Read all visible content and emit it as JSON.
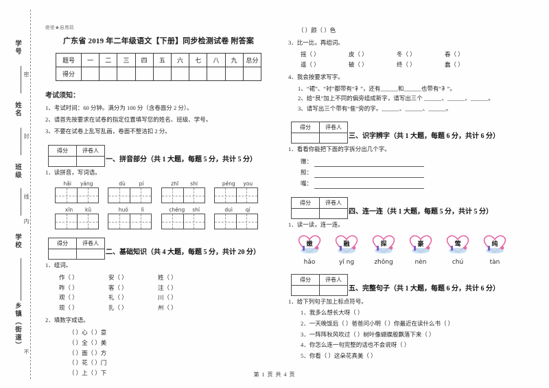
{
  "document": {
    "secret_line": "绝密★启用前",
    "title": "广东省 2019 年二年级语文【下册】同步检测试卷 附答案",
    "footer": "第 1 页 共 4 页"
  },
  "seal_margin": {
    "fields": [
      {
        "label": "学号",
        "sub": "密"
      },
      {
        "label": "姓名",
        "sub": "封"
      },
      {
        "label": "班级",
        "sub": "线"
      },
      {
        "label": "学校",
        "sub": "内"
      },
      {
        "label": "乡镇（街道）",
        "sub": "不"
      }
    ]
  },
  "score_table": {
    "row_labels": [
      "题号",
      "得分"
    ],
    "columns": [
      "一",
      "二",
      "三",
      "四",
      "五",
      "六",
      "七",
      "八",
      "九",
      "总分"
    ],
    "scores": [
      "",
      "",
      "",
      "",
      "",
      "",
      "",
      "",
      "",
      ""
    ]
  },
  "notice": {
    "title": "考试须知：",
    "items": [
      "1、考试时间：60 分钟。满分为 100 分（含卷面分 2 分）。",
      "2、请首先按要求在试卷的指定位置填写您的姓名、班级、学号。",
      "3、不要在试卷上乱写乱画，卷面不整洁扣 2 分。"
    ]
  },
  "grader_box": {
    "score_label": "得分",
    "marker_label": "评卷人"
  },
  "sections": [
    {
      "id": "s1",
      "title": "一、拼音部分（共 1 大题，每题 5 分，共计 5 分）",
      "question": "1．读拼音，写词语。",
      "pinyin_rows": [
        [
          {
            "syllables": [
              "hǎi",
              "yáng"
            ]
          },
          {
            "syllables": [
              "dù",
              "pí"
            ]
          },
          {
            "syllables": [
              "zhī",
              "shi"
            ]
          },
          {
            "syllables": [
              "péng",
              "you"
            ]
          }
        ],
        [
          {
            "syllables": [
              "xīn",
              "kǔ"
            ]
          },
          {
            "syllables": [
              "huó",
              "lì"
            ]
          },
          {
            "syllables": [
              "chéng",
              "shí"
            ]
          },
          {
            "syllables": [
              "duì",
              "qí"
            ]
          }
        ]
      ]
    },
    {
      "id": "s2",
      "title": "二、基础知识（共 4 大题，每题 5 分，共计 20 分）",
      "q1_label": "1．组词。",
      "word_rows": [
        [
          "作（      ）",
          "安（      ）",
          "姓（      ）"
        ],
        [
          "昨（      ）",
          "客（      ）",
          "注（      ）"
        ],
        [
          "观（      ）",
          "礼（      ）",
          "川（      ）"
        ],
        [
          "现（      ）",
          "扎（      ）",
          "州（      ）"
        ]
      ],
      "q2_label": "2．填数字成语。",
      "idioms": [
        "（      ）心（      ）意",
        "（      ）全（      ）美",
        "（      ）面（      ）方",
        "（      ）花（      ）门",
        "（      ）上（      ）下",
        "（      ）颜（      ）色"
      ],
      "q3_label": "3．比一比，再组词。",
      "compare_rows": [
        [
          "摇（      ）",
          "皮（      ）",
          "冬（      ）",
          "春（      ）"
        ],
        [
          "遥（      ）",
          "破（      ）",
          "终（      ）",
          "蠢（      ）"
        ]
      ],
      "q4_label": "4．我会按要求写字。",
      "q4_items": [
        "1、“裙”、“衬”都带有“衤”，还有______和______也带有“衤”。",
        "2、给“艮”加上不同的偏旁组成新字，请写出三个 ______、______、______。",
        "3、请写出三个带有“隹”旁的字。______、______、______。"
      ]
    },
    {
      "id": "s3",
      "title": "三、识字辨字（共 1 大题，每题 6 分，共计 6 分）",
      "question": "1．看看你能把下面的字拆分出几个字。",
      "split_chars": [
        "赠：",
        "照：",
        "嘴："
      ]
    },
    {
      "id": "s4",
      "title": "四、连一连（共 1 大题，每题 5 分，共计 5 分）",
      "question": "1．读一读，连一连。",
      "hearts": [
        {
          "char": "嫩",
          "pinyin": "hǎo"
        },
        {
          "char": "融",
          "pinyin": "yī ng"
        },
        {
          "char": "探",
          "pinyin": "zhǒng"
        },
        {
          "char": "豪",
          "pinyin": "nèn"
        },
        {
          "char": "莺",
          "pinyin": "chú"
        },
        {
          "char": "纯",
          "pinyin": "tàn"
        }
      ],
      "heart_outline_color": "#e26ba8",
      "heart_base_color": "#6aa9dd"
    },
    {
      "id": "s5",
      "title": "五、完整句子（共 1 大题，每题 6 分，共计 6 分）",
      "question": "1．给下列句子加上标点符号。",
      "punct_items": [
        "1．我多么想长大呀（      ）",
        "2．一天晚饭后（      ）爸爸问小明（      ）你最近在读什么书（      ）",
        "3．一阵阵秋风吹过（      ）树叶像蝴蝶般飘落下来（      ）",
        "4．你怎么连一句完整的话也不会说呀（      ）",
        "5．你看（      ）这朵花真美（      ）"
      ]
    }
  ]
}
